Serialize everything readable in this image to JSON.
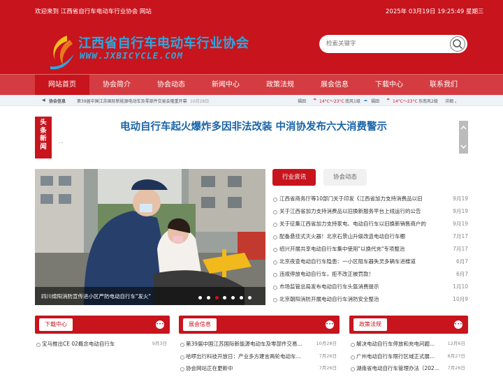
{
  "topbar": {
    "welcome": "欢迎来到 江西省自行车电动车行业协会 网站",
    "datetime": "2025年 03月19日  19:25:49  星期三"
  },
  "logo": {
    "cn": "江西省自行车电动车行业协会",
    "en": "WWW.JXBICYCLE.COM"
  },
  "search": {
    "placeholder": "检索关键字"
  },
  "nav": [
    "网站首页",
    "协会简介",
    "协会动态",
    "新闻中心",
    "政策法规",
    "展会信息",
    "下载中心",
    "联系我们"
  ],
  "infobar": {
    "label": "协会信息",
    "text": "第39届中国江苏国际新能源电动车及零部件交易会隆重开幕",
    "date": "10月28日",
    "weather1": "福田",
    "temp1": "14°C～23°C",
    "wind1": "南风1级",
    "city2": "福田",
    "temp2": "14°C～23°C",
    "wind2": "东南风2级",
    "detail": "详细"
  },
  "headline": {
    "tag": [
      "头",
      "条",
      "新",
      "闻"
    ],
    "title": "电动自行车起火爆炸多因非法改装 中消协发布六大消费警示",
    "sub": "..."
  },
  "slider": {
    "caption": "四川绵阳消防宣传进小区严防电动自行车\"发火\"",
    "active_index": 2,
    "dot_count": 7
  },
  "tabs": [
    "行业资讯",
    "协会动态"
  ],
  "news": [
    {
      "title": "江西省商务厅等10部门关于印发《江西省加力支持消费品以旧",
      "date": "9月19"
    },
    {
      "title": "关于江西省加力支持消费品以旧换新服务平台上线运行的公告",
      "date": "9月19"
    },
    {
      "title": "关于征集江西省加力支持家电、电动自行车以旧换新销售商户的",
      "date": "9月19"
    },
    {
      "title": "配备悬挂式灭火器！北京石景山升级改造电动自行车棚",
      "date": "7月17"
    },
    {
      "title": "绍兴开展共享电动自行车集中使用\"以换代充\"专项整治",
      "date": "7月17"
    },
    {
      "title": "北京夜查电动自行车隐患：一小区阻车器失灵多辆车进楼道",
      "date": "6月7"
    },
    {
      "title": "违规停放电动自行车，拒不改正被罚款！",
      "date": "6月7"
    },
    {
      "title": "市场监管总局发布电动自行车头盔消费提示",
      "date": "1月10"
    },
    {
      "title": "北京朝阳消防开展电动自行车消防安全整治",
      "date": "10月9"
    }
  ],
  "panels": [
    {
      "title": "下载中心",
      "items": [
        {
          "title": "宝马推出CE 02概念电动自行车",
          "date": "9月3日"
        }
      ]
    },
    {
      "title": "展会信息",
      "items": [
        {
          "title": "第39届中国江苏国际新能源电动车及零部件交易...",
          "date": "10月28日"
        },
        {
          "title": "哈啰出行科技开放日：产业多方建言两轮电动车...",
          "date": "7月26日"
        },
        {
          "title": "协会网站正在更新中",
          "date": "7月26日"
        }
      ]
    },
    {
      "title": "政策法规",
      "items": [
        {
          "title": "解决电动自行车停放和充电问题...",
          "date": "12月6日"
        },
        {
          "title": "广州电动自行车限行区域正式展...",
          "date": "8月27日"
        },
        {
          "title": "湖南省电动自行车管理办法（202...",
          "date": "7月26日"
        }
      ]
    }
  ],
  "more_glyph": "•••",
  "colors": {
    "brand_red": "#c8141d",
    "nav_red": "#d43c41",
    "headline_blue": "#1a64a8",
    "logo_blue": "#2aa9e0"
  }
}
